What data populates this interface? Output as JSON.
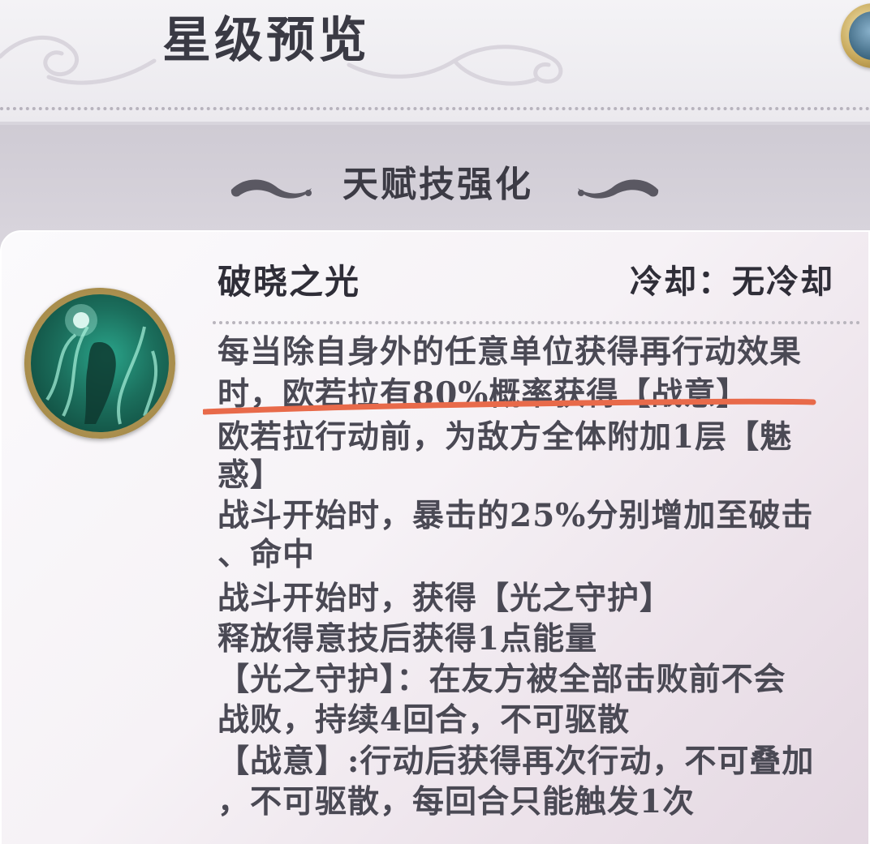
{
  "header": {
    "title": "星级预览",
    "close_icon": "close-icon"
  },
  "section": {
    "title": "天赋技强化"
  },
  "skill": {
    "name": "破晓之光",
    "cooldown": "冷却：无冷却",
    "icon": "skill-portrait-icon",
    "description_lines": [
      "每当除自身外的任意单位获得再行动效果",
      "时，欧若拉有80%概率获得【战意】",
      "欧若拉行动前，为敌方全体附加1层【魅",
      "惑】",
      "战斗开始时，暴击的25%分别增加至破击",
      "、命中",
      "战斗开始时，获得【光之守护】",
      "释放得意技后获得1点能量",
      "【光之守护】：在友方被全部击败前不会",
      "战败，持续4回合，不可驱散",
      "【战意】:行动后获得再次行动，不可叠加",
      "，不可驱散，每回合只能触发1次"
    ]
  },
  "colors": {
    "annotation_underline": "#e86a4a",
    "title_text": "#3a3a44",
    "body_text": "#4a4954"
  }
}
